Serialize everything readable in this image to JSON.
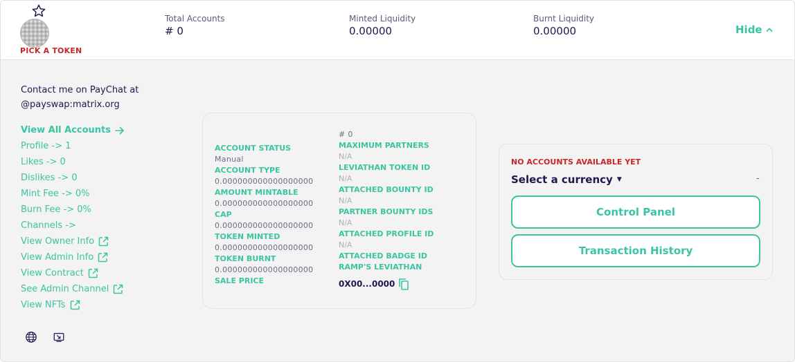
{
  "header": {
    "pick_token": "PICK A TOKEN",
    "stats": [
      {
        "label": "Total Accounts",
        "value": "# 0"
      },
      {
        "label": "Minted Liquidity",
        "value": "0.00000"
      },
      {
        "label": "Burnt Liquidity",
        "value": "0.00000"
      }
    ],
    "hide_label": "Hide"
  },
  "sidebar": {
    "contact_line1": "Contact me on PayChat at",
    "contact_line2": "@payswap:matrix.org",
    "items": [
      {
        "label": "View All Accounts",
        "icon": "arrow-right-icon"
      },
      {
        "label": "Profile -> 1",
        "icon": ""
      },
      {
        "label": "Likes -> 0",
        "icon": ""
      },
      {
        "label": "Dislikes -> 0",
        "icon": ""
      },
      {
        "label": "Mint Fee -> 0%",
        "icon": ""
      },
      {
        "label": "Burn Fee -> 0%",
        "icon": ""
      },
      {
        "label": "Channels ->",
        "icon": ""
      },
      {
        "label": "View Owner Info",
        "icon": "external-link-icon"
      },
      {
        "label": "View Admin Info",
        "icon": "external-link-icon"
      },
      {
        "label": "View Contract",
        "icon": "external-link-icon"
      },
      {
        "label": "See Admin Channel",
        "icon": "external-link-icon"
      },
      {
        "label": "View NFTs",
        "icon": "external-link-icon"
      }
    ]
  },
  "card": {
    "left": [
      {
        "type": "label",
        "text": "ACCOUNT STATUS"
      },
      {
        "type": "value",
        "text": "Manual"
      },
      {
        "type": "label",
        "text": "ACCOUNT TYPE"
      },
      {
        "type": "value",
        "text": "0.000000000000000000"
      },
      {
        "type": "label",
        "text": "AMOUNT MINTABLE"
      },
      {
        "type": "value",
        "text": "0.000000000000000000"
      },
      {
        "type": "label",
        "text": "CAP"
      },
      {
        "type": "value",
        "text": "0.000000000000000000"
      },
      {
        "type": "label",
        "text": "TOKEN MINTED"
      },
      {
        "type": "value",
        "text": "0.000000000000000000"
      },
      {
        "type": "label",
        "text": "TOKEN BURNT"
      },
      {
        "type": "value",
        "text": "0.000000000000000000"
      },
      {
        "type": "label",
        "text": "SALE PRICE"
      }
    ],
    "right": [
      {
        "type": "value",
        "text": "# 0"
      },
      {
        "type": "label",
        "text": "MAXIMUM PARTNERS"
      },
      {
        "type": "na",
        "text": "N/A"
      },
      {
        "type": "label",
        "text": "LEVIATHAN TOKEN ID"
      },
      {
        "type": "na",
        "text": "N/A"
      },
      {
        "type": "label",
        "text": "ATTACHED BOUNTY ID"
      },
      {
        "type": "na",
        "text": "N/A"
      },
      {
        "type": "label",
        "text": "PARTNER BOUNTY IDS"
      },
      {
        "type": "na",
        "text": "N/A"
      },
      {
        "type": "label",
        "text": "ATTACHED PROFILE ID"
      },
      {
        "type": "na",
        "text": "N/A"
      },
      {
        "type": "label",
        "text": "ATTACHED BADGE ID"
      },
      {
        "type": "label",
        "text": "RAMP'S LEVIATHAN"
      }
    ],
    "address": "0X00...0000"
  },
  "panel": {
    "no_accounts": "NO ACCOUNTS AVAILABLE YET",
    "currency_label": "Select a currency",
    "dash": "-",
    "control_panel": "Control Panel",
    "transaction_history": "Transaction History"
  },
  "colors": {
    "accent": "#3cc4a2",
    "alert": "#c62828",
    "ink": "#1e1850"
  }
}
